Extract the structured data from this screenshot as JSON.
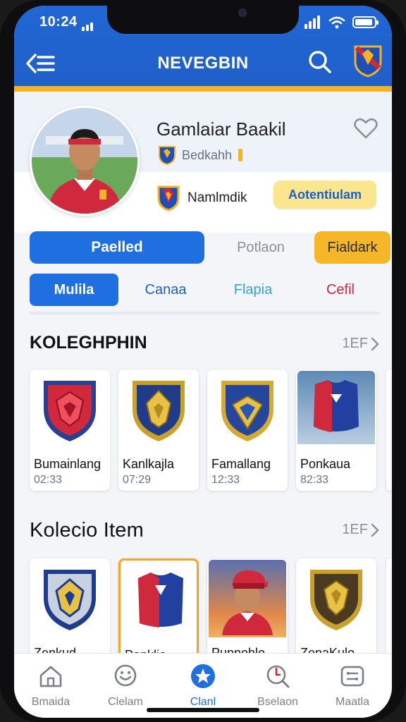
{
  "status": {
    "time": "10:24"
  },
  "nav": {
    "title": "NEVEGBIN"
  },
  "profile": {
    "name": "Gamlaiar Baakil",
    "club": "Bedkahh",
    "club2": "Namlmdik",
    "badge": "Aotentiulam"
  },
  "actions": {
    "primary": "Paelled",
    "secondary": "Potlaon",
    "tertiary": "Fialdark"
  },
  "tabs": [
    "Mulila",
    "Canaa",
    "Flapia",
    "Cefil"
  ],
  "section1": {
    "title": "KOLEGHPHIN",
    "more": "1EF",
    "cards": [
      {
        "name": "Bumainlang",
        "time": "02:33"
      },
      {
        "name": "Kanlkajla",
        "time": "07:29"
      },
      {
        "name": "Famallang",
        "time": "12:33"
      },
      {
        "name": "Ponkaua",
        "time": "82:33"
      }
    ]
  },
  "section2": {
    "title": "Kolecio Item",
    "more": "1EF",
    "cards": [
      {
        "name": "Zenkud"
      },
      {
        "name": "Panklia"
      },
      {
        "name": "Pupnohlo"
      },
      {
        "name": "ZenaKulo"
      }
    ]
  },
  "tabbar": [
    {
      "label": "Bmaida",
      "icon": "home-icon"
    },
    {
      "label": "Clelam",
      "icon": "chat-icon"
    },
    {
      "label": "Clanl",
      "icon": "star-icon",
      "active": true
    },
    {
      "label": "Bselaon",
      "icon": "search-icon"
    },
    {
      "label": "Maatla",
      "icon": "ticket-icon"
    }
  ],
  "colors": {
    "primary": "#1f6fe0",
    "accent": "#f5b627",
    "header": "#2166d4"
  }
}
